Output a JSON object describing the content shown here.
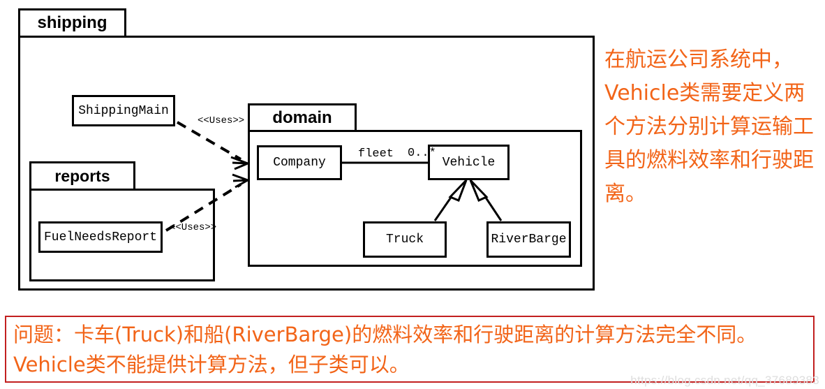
{
  "diagram": {
    "packages": [
      {
        "name": "shipping",
        "label": "shipping"
      },
      {
        "name": "reports",
        "label": "reports"
      },
      {
        "name": "domain",
        "label": "domain"
      }
    ],
    "classes": [
      {
        "name": "shipping-main",
        "label": "ShippingMain"
      },
      {
        "name": "fuel-needs-report",
        "label": "FuelNeedsReport"
      },
      {
        "name": "company",
        "label": "Company"
      },
      {
        "name": "vehicle",
        "label": "Vehicle"
      },
      {
        "name": "truck",
        "label": "Truck"
      },
      {
        "name": "river-barge",
        "label": "RiverBarge"
      }
    ],
    "relations": {
      "uses_from_main": "<<Uses>>",
      "uses_from_report": "<<Uses>>",
      "association_role": "fleet",
      "association_multiplicity": "0..*",
      "generalizations": [
        {
          "from": "Truck",
          "to": "Vehicle"
        },
        {
          "from": "RiverBarge",
          "to": "Vehicle"
        }
      ]
    }
  },
  "side_note": {
    "text": "在航运公司系统中，Vehicle类需要定义两个方法分别计算运输工具的燃料效率和行驶距离。",
    "color": "#f26418"
  },
  "problem": {
    "text": "问题：卡车(Truck)和船(RiverBarge)的燃料效率和行驶距离的计算方法完全不同。Vehicle类不能提供计算方法，但子类可以。",
    "text_color": "#f26418",
    "border_color": "#c21f1f"
  },
  "watermark": {
    "text": "https://blog.csdn.net/qq_37689383"
  }
}
